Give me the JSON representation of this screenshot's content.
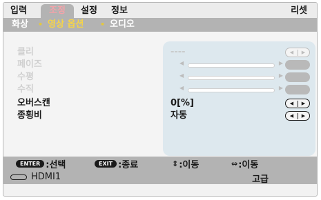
{
  "tabs": [
    "입력",
    "조정",
    "설정",
    "정보"
  ],
  "reset_label": "리셋",
  "sub_tabs": [
    "화상",
    "영상 옵션",
    "오디오"
  ],
  "sub_sep": "•",
  "rows": [
    {
      "label": "클리",
      "value": "----"
    },
    {
      "label": "페이즈",
      "value": ""
    },
    {
      "label": "수평",
      "value": ""
    },
    {
      "label": "수직",
      "value": ""
    },
    {
      "label": "오버스캔",
      "value": "0[%]"
    },
    {
      "label": "종횡비",
      "value": "자동"
    }
  ],
  "arrow_left": "◀",
  "arrow_right": "▶",
  "help": {
    "enter_key": "ENTER",
    "enter_text": ":선택",
    "exit_key": "EXIT",
    "exit_text": ":종료",
    "updown_glyph": "⇕",
    "updown_text": ":이동",
    "leftright_glyph": "⇔",
    "leftright_text": ":이동"
  },
  "source_label": "HDMI1",
  "level_label": "고급",
  "colors": {
    "bar_gray": "#b3b3b3",
    "active_tab_text": "#f3a3a9",
    "active_subtab_text": "#f5d44a",
    "panel_blue": "#dde8ee"
  }
}
